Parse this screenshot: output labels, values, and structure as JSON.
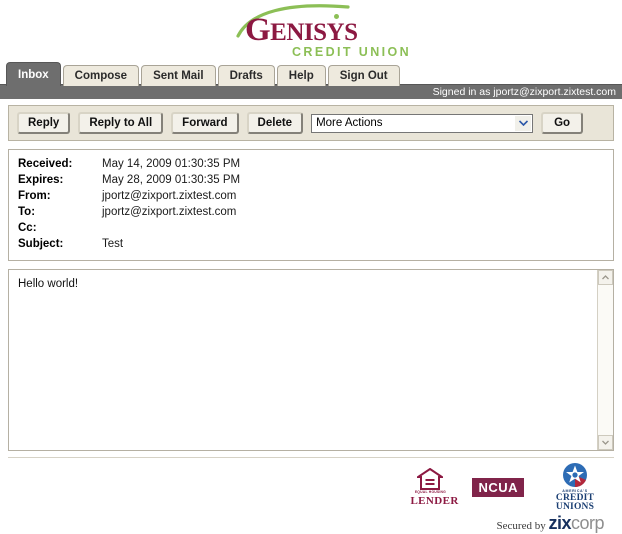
{
  "brand": {
    "name": "GENISYS",
    "name_caps_small": "ENISYS",
    "tagline": "CREDIT UNION",
    "wordmark_color": "#8c1942",
    "accent_color": "#8cbf56"
  },
  "tabs": [
    {
      "label": "Inbox",
      "active": true
    },
    {
      "label": "Compose",
      "active": false
    },
    {
      "label": "Sent Mail",
      "active": false
    },
    {
      "label": "Drafts",
      "active": false
    },
    {
      "label": "Help",
      "active": false
    },
    {
      "label": "Sign Out",
      "active": false
    }
  ],
  "session": {
    "signed_in_text": "Signed in as jportz@zixport.zixtest.com"
  },
  "toolbar": {
    "reply_label": "Reply",
    "reply_all_label": "Reply to All",
    "forward_label": "Forward",
    "delete_label": "Delete",
    "more_actions_selected": "More Actions",
    "go_label": "Go"
  },
  "message": {
    "fields": [
      {
        "label": "Received:",
        "value": "May 14, 2009 01:30:35 PM"
      },
      {
        "label": "Expires:",
        "value": "May 28, 2009 01:30:35 PM"
      },
      {
        "label": "From:",
        "value": "jportz@zixport.zixtest.com"
      },
      {
        "label": "To:",
        "value": "jportz@zixport.zixtest.com"
      },
      {
        "label": "Cc:",
        "value": ""
      },
      {
        "label": "Subject:",
        "value": "Test"
      }
    ],
    "body": "Hello world!"
  },
  "footer": {
    "equal_housing": {
      "caption": "EQUAL HOUSING",
      "name": "LENDER"
    },
    "ncua_label": "NCUA",
    "credit_unions": {
      "superscript": "AMERICA'S",
      "name": "CREDIT UNIONS"
    },
    "secured_prefix": "Secured by ",
    "secured_brand_bold": "zix",
    "secured_brand_light": "corp"
  }
}
